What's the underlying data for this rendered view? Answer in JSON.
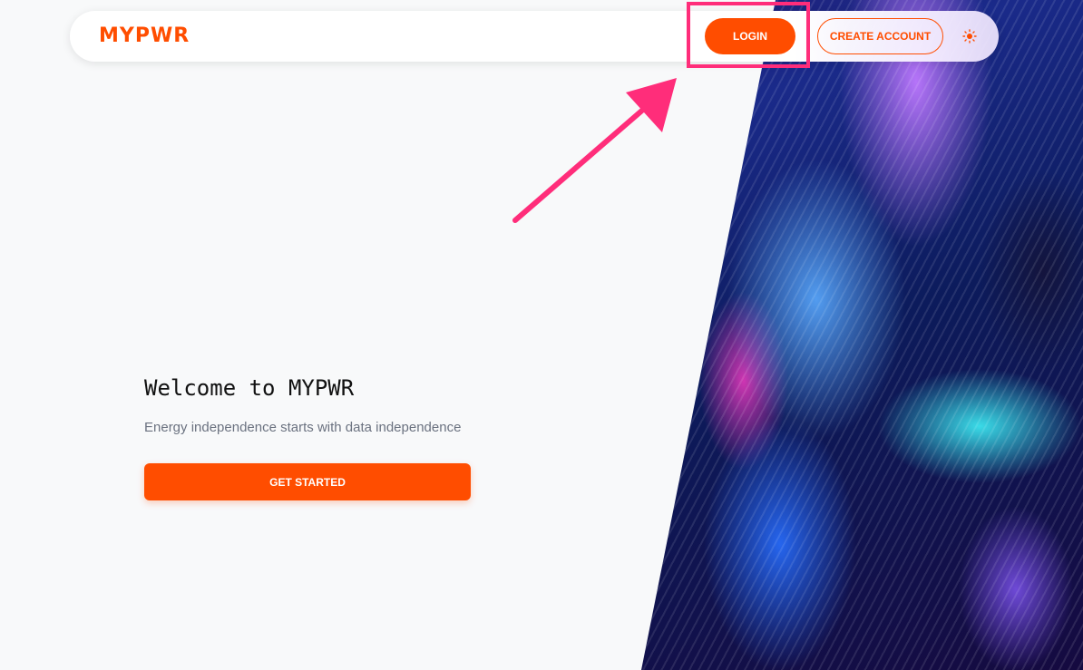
{
  "header": {
    "logo": "MYPWR",
    "login_label": "LOGIN",
    "create_account_label": "CREATE ACCOUNT",
    "theme_toggle_icon": "sun-icon"
  },
  "hero": {
    "title": "Welcome to MYPWR",
    "subtitle": "Energy independence starts with data independence",
    "cta_label": "GET STARTED"
  },
  "annotation": {
    "highlight_color": "#ff2d7a",
    "arrow_icon": "arrow-icon"
  },
  "colors": {
    "brand": "#ff4d00",
    "background": "#f8f9fa"
  }
}
